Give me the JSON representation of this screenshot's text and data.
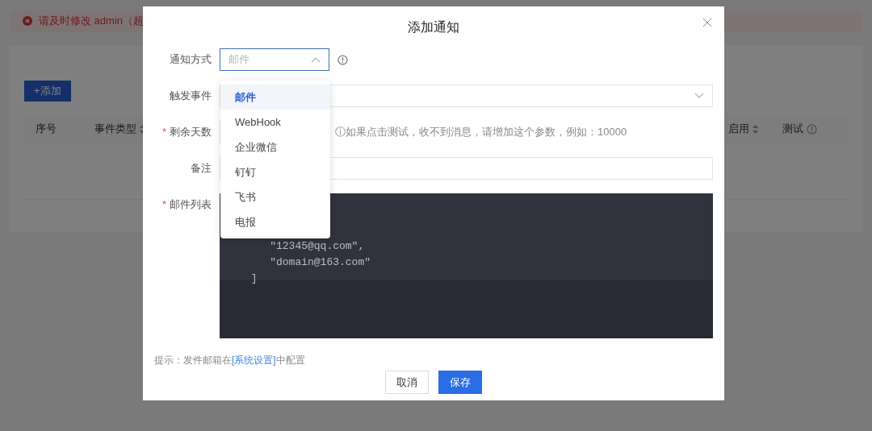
{
  "background": {
    "alert": "请及时修改 admin（超",
    "add_button": "+添加",
    "table_columns": [
      {
        "label": "序号",
        "kind": "plain"
      },
      {
        "label": "事件类型",
        "kind": "sortable"
      },
      {
        "label": "启用",
        "kind": "sortable"
      },
      {
        "label": "测试",
        "kind": "info"
      }
    ]
  },
  "dialog": {
    "title": "添加通知",
    "fields": [
      {
        "kind": "select",
        "label": "通知方式",
        "placeholder": "邮件",
        "open": true,
        "info": true
      },
      {
        "kind": "select",
        "label": "触发事件",
        "open": false,
        "info": false
      },
      {
        "kind": "number",
        "label": "剩余天数",
        "required_mark": "*",
        "hint": "ⓘ如果点击测试，收不到消息，请增加这个参数，例如：10000"
      },
      {
        "kind": "text",
        "label": "备注"
      },
      {
        "kind": "code",
        "label": "邮件列表",
        "required_mark": "*",
        "code": "    \"12345@qq.com\",\n    \"domain@163.com\"\n ]"
      }
    ],
    "footer_hint": {
      "prefix": "提示：发件邮箱在",
      "link": "[系统设置]",
      "suffix": "中配置"
    },
    "buttons": [
      {
        "label": "取消",
        "primary": false
      },
      {
        "label": "保存",
        "primary": true
      }
    ],
    "dropdown": {
      "options": [
        {
          "label": "邮件",
          "selected": true
        },
        {
          "label": "WebHook",
          "selected": false
        },
        {
          "label": "企业微信",
          "selected": false
        },
        {
          "label": "钉钉",
          "selected": false
        },
        {
          "label": "飞书",
          "selected": false
        },
        {
          "label": "电报",
          "selected": false
        }
      ]
    }
  }
}
